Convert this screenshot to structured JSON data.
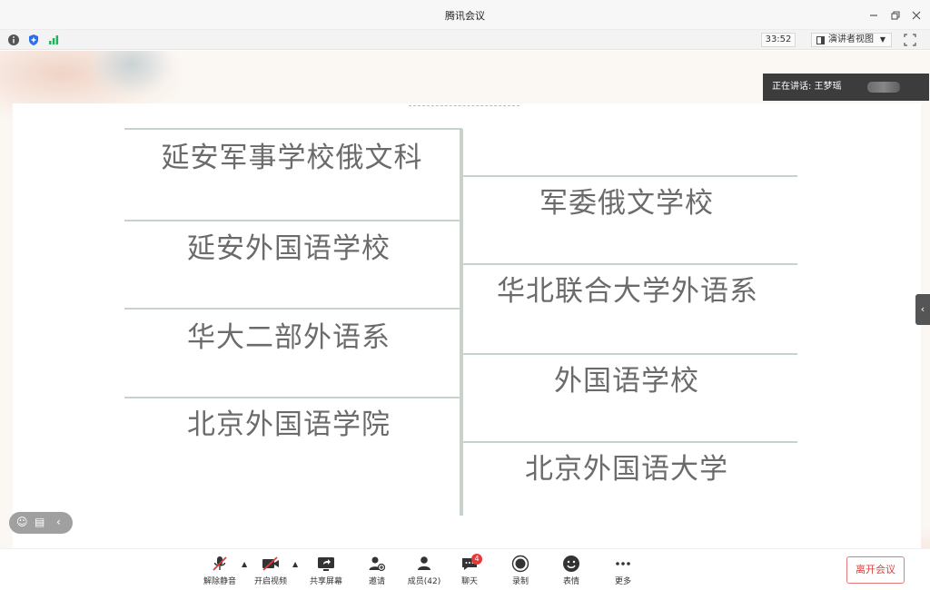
{
  "window": {
    "title": "腾讯会议"
  },
  "infobar": {
    "timer": "33:52",
    "view_label": "演讲者视图"
  },
  "stage": {
    "speaking_text": "正在讲话: 王梦瑶"
  },
  "diagram": {
    "left": [
      "延安军事学校俄文科",
      "延安外国语学校",
      "华大二部外语系",
      "北京外国语学院"
    ],
    "right": [
      "军委俄文学校",
      "华北联合大学外语系",
      "外国语学校",
      "北京外国语大学"
    ]
  },
  "toolbar": {
    "unmute": "解除静音",
    "video": "开启视频",
    "share": "共享屏幕",
    "invite": "邀请",
    "members": "成员(42)",
    "chat": "聊天",
    "chat_badge": "4",
    "record": "录制",
    "emoji": "表情",
    "more": "更多",
    "leave": "离开会议"
  },
  "colors": {
    "leave": "#d9403f",
    "badge": "#e5393a",
    "diagram_line": "#c7d3ca",
    "diagram_text": "#6b6b6b"
  }
}
